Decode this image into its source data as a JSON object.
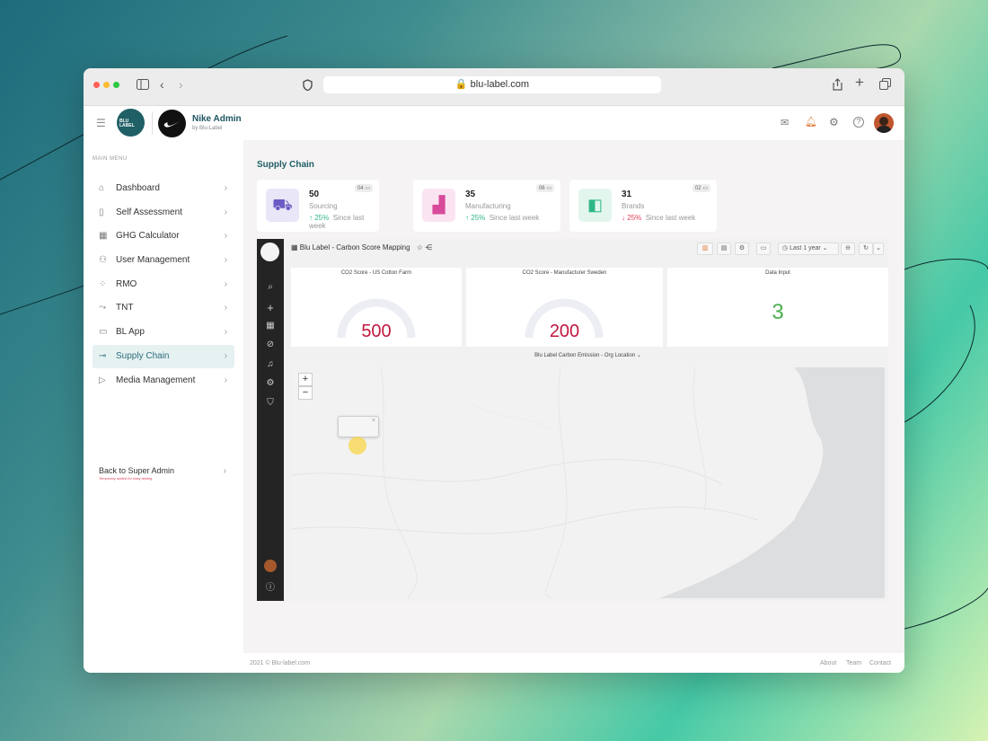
{
  "browser": {
    "url": "blu-label.com"
  },
  "header": {
    "logo_text": "BLU LABEL",
    "account_name": "Nike Admin",
    "account_sub": "by Blu-Label"
  },
  "sidebar": {
    "section_title": "MAIN MENU",
    "items": [
      {
        "label": "Dashboard",
        "icon": "home-icon"
      },
      {
        "label": "Self Assessment",
        "icon": "document-icon"
      },
      {
        "label": "GHG Calculator",
        "icon": "calculator-icon"
      },
      {
        "label": "User Management",
        "icon": "users-icon"
      },
      {
        "label": "RMO",
        "icon": "grid-icon"
      },
      {
        "label": "TNT",
        "icon": "route-icon"
      },
      {
        "label": "BL App",
        "icon": "app-icon"
      },
      {
        "label": "Supply Chain",
        "icon": "link-icon",
        "active": true
      },
      {
        "label": "Media Management",
        "icon": "video-icon"
      }
    ],
    "back_label": "Back to Super Admin",
    "back_note": "Temporary added for easy testing"
  },
  "page": {
    "title": "Supply Chain"
  },
  "stats": [
    {
      "value": "50",
      "label": "Sourcing",
      "change": "25%",
      "direction": "up",
      "since": "Since last week",
      "badge": "04",
      "icon": "tractor-icon"
    },
    {
      "value": "35",
      "label": "Manufacturing",
      "change": "25%",
      "direction": "up",
      "since": "Since last week",
      "badge": "06",
      "icon": "factory-icon"
    },
    {
      "value": "31",
      "label": "Brands",
      "change": "25%",
      "direction": "down",
      "since": "Since last week",
      "badge": "02",
      "icon": "shopping-bag-icon"
    }
  ],
  "dashboard": {
    "title": "Blu Label - Carbon Score Mapping",
    "time_range": "Last 1 year",
    "cards": [
      {
        "title": "CO2 Score - US Cotton Farm",
        "value": "500",
        "type": "gauge"
      },
      {
        "title": "CO2 Score - Manufacturer Sweden",
        "value": "200",
        "type": "gauge"
      },
      {
        "title": "Data Input",
        "value": "3",
        "type": "stat"
      }
    ],
    "map_title": "Blu Label Carbon Emission - Org Location"
  },
  "footer": {
    "copyright": "2021 © Blu-label.com",
    "links": [
      "About",
      "Team",
      "Contact"
    ]
  },
  "colors": {
    "accent": "#2b6f7b",
    "up": "#2fb886",
    "down": "#e0405a",
    "gauge_value": "#c2173f",
    "stat_value": "#4caf50"
  }
}
